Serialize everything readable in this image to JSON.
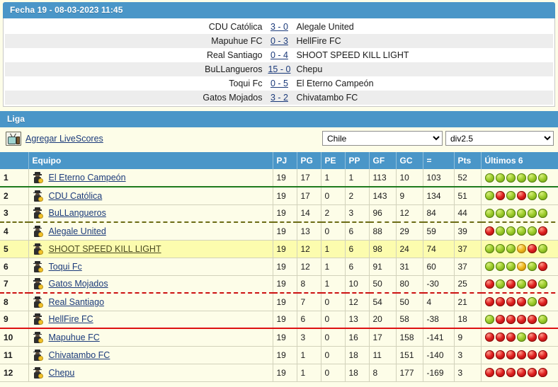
{
  "fecha": {
    "title": "Fecha 19 - 08-03-2023 11:45",
    "matches": [
      {
        "home": "CDU Católica",
        "score": "3 - 0",
        "away": "Alegale United"
      },
      {
        "home": "Mapuhue FC",
        "score": "0 - 3",
        "away": "HellFire FC"
      },
      {
        "home": "Real Santiago",
        "score": "0 - 4",
        "away": "SHOOT SPEED KILL LIGHT"
      },
      {
        "home": "BuLLangueros",
        "score": "15 - 0",
        "away": "Chepu"
      },
      {
        "home": "Toqui Fc",
        "score": "0 - 5",
        "away": "El Eterno Campeón"
      },
      {
        "home": "Gatos Mojados",
        "score": "3 - 2",
        "away": "Chivatambo FC"
      }
    ]
  },
  "liga": {
    "title": "Liga",
    "livescores_label": "Agregar LiveScores",
    "tv_icon": "tv-icon",
    "country_select": {
      "value": "Chile",
      "options": [
        "Chile"
      ]
    },
    "division_select": {
      "value": "div2.5",
      "options": [
        "div2.5"
      ]
    },
    "columns": [
      "",
      "Equipo",
      "PJ",
      "PG",
      "PE",
      "PP",
      "GF",
      "GC",
      "=",
      "Pts",
      "Últimos 6"
    ],
    "rows": [
      {
        "pos": "1",
        "team": "El Eterno Campeón",
        "pj": "19",
        "pg": "17",
        "pe": "1",
        "pp": "1",
        "gf": "113",
        "gc": "10",
        "dif": "103",
        "pts": "52",
        "form": [
          "W",
          "W",
          "W",
          "W",
          "W",
          "W"
        ],
        "sep": "sep-green",
        "hl": false
      },
      {
        "pos": "2",
        "team": "CDU Católica",
        "pj": "19",
        "pg": "17",
        "pe": "0",
        "pp": "2",
        "gf": "143",
        "gc": "9",
        "dif": "134",
        "pts": "51",
        "form": [
          "W",
          "L",
          "W",
          "L",
          "W",
          "W"
        ],
        "sep": "",
        "hl": false
      },
      {
        "pos": "3",
        "team": "BuLLangueros",
        "pj": "19",
        "pg": "14",
        "pe": "2",
        "pp": "3",
        "gf": "96",
        "gc": "12",
        "dif": "84",
        "pts": "44",
        "form": [
          "W",
          "W",
          "W",
          "W",
          "W",
          "W"
        ],
        "sep": "sep-dashed-olive",
        "hl": false
      },
      {
        "pos": "4",
        "team": "Alegale United",
        "pj": "19",
        "pg": "13",
        "pe": "0",
        "pp": "6",
        "gf": "88",
        "gc": "29",
        "dif": "59",
        "pts": "39",
        "form": [
          "L",
          "W",
          "W",
          "W",
          "W",
          "L"
        ],
        "sep": "",
        "hl": false
      },
      {
        "pos": "5",
        "team": "SHOOT SPEED KILL LIGHT",
        "pj": "19",
        "pg": "12",
        "pe": "1",
        "pp": "6",
        "gf": "98",
        "gc": "24",
        "dif": "74",
        "pts": "37",
        "form": [
          "W",
          "W",
          "W",
          "D",
          "L",
          "W"
        ],
        "sep": "",
        "hl": true
      },
      {
        "pos": "6",
        "team": "Toqui Fc",
        "pj": "19",
        "pg": "12",
        "pe": "1",
        "pp": "6",
        "gf": "91",
        "gc": "31",
        "dif": "60",
        "pts": "37",
        "form": [
          "W",
          "W",
          "W",
          "D",
          "W",
          "L"
        ],
        "sep": "",
        "hl": false
      },
      {
        "pos": "7",
        "team": "Gatos Mojados",
        "pj": "19",
        "pg": "8",
        "pe": "1",
        "pp": "10",
        "gf": "50",
        "gc": "80",
        "dif": "-30",
        "pts": "25",
        "form": [
          "L",
          "W",
          "L",
          "W",
          "L",
          "W"
        ],
        "sep": "sep-dashed-red",
        "hl": false
      },
      {
        "pos": "8",
        "team": "Real Santiago",
        "pj": "19",
        "pg": "7",
        "pe": "0",
        "pp": "12",
        "gf": "54",
        "gc": "50",
        "dif": "4",
        "pts": "21",
        "form": [
          "L",
          "L",
          "L",
          "L",
          "W",
          "L"
        ],
        "sep": "",
        "hl": false
      },
      {
        "pos": "9",
        "team": "HellFire FC",
        "pj": "19",
        "pg": "6",
        "pe": "0",
        "pp": "13",
        "gf": "20",
        "gc": "58",
        "dif": "-38",
        "pts": "18",
        "form": [
          "W",
          "L",
          "L",
          "L",
          "L",
          "W"
        ],
        "sep": "sep-solid-red",
        "hl": false
      },
      {
        "pos": "10",
        "team": "Mapuhue FC",
        "pj": "19",
        "pg": "3",
        "pe": "0",
        "pp": "16",
        "gf": "17",
        "gc": "158",
        "dif": "-141",
        "pts": "9",
        "form": [
          "L",
          "L",
          "L",
          "W",
          "L",
          "L"
        ],
        "sep": "",
        "hl": false
      },
      {
        "pos": "11",
        "team": "Chivatambo FC",
        "pj": "19",
        "pg": "1",
        "pe": "0",
        "pp": "18",
        "gf": "11",
        "gc": "151",
        "dif": "-140",
        "pts": "3",
        "form": [
          "L",
          "L",
          "L",
          "L",
          "L",
          "L"
        ],
        "sep": "",
        "hl": false
      },
      {
        "pos": "12",
        "team": "Chepu",
        "pj": "19",
        "pg": "1",
        "pe": "0",
        "pp": "18",
        "gf": "8",
        "gc": "177",
        "dif": "-169",
        "pts": "3",
        "form": [
          "L",
          "L",
          "L",
          "L",
          "L",
          "L"
        ],
        "sep": "",
        "hl": false
      }
    ]
  },
  "colors": {
    "header_blue": "#4a96c8",
    "page_bg": "#fdfde8",
    "highlight_row": "#fcfcae",
    "link": "#1b3a7a",
    "win": "#9ccc2a",
    "loss": "#e02020",
    "draw": "#f0b81c",
    "promotion_line": "#1e7a1e",
    "playoff_line": "#6b6b14",
    "relegation_line": "#dd1111"
  }
}
